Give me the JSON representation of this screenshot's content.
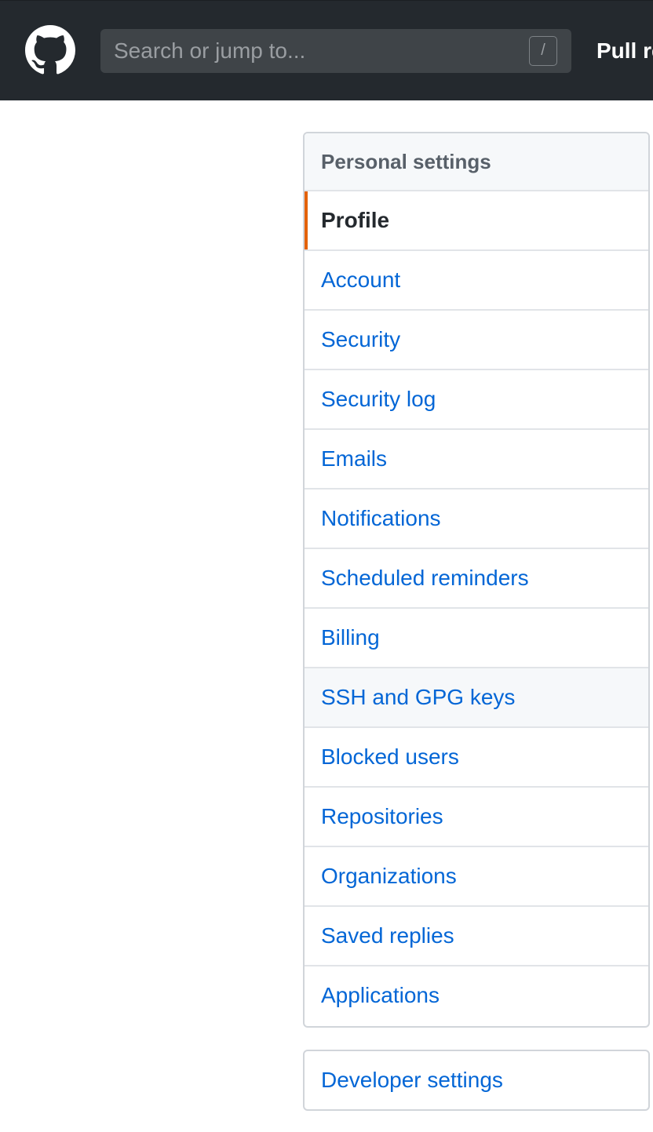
{
  "header": {
    "logo_icon": "github-mark-icon",
    "search": {
      "placeholder": "Search or jump to...",
      "shortcut": "/"
    },
    "nav_link": "Pull re"
  },
  "settings_menu": {
    "heading": "Personal settings",
    "items": [
      {
        "label": "Profile",
        "selected": true
      },
      {
        "label": "Account"
      },
      {
        "label": "Security"
      },
      {
        "label": "Security log"
      },
      {
        "label": "Emails"
      },
      {
        "label": "Notifications"
      },
      {
        "label": "Scheduled reminders"
      },
      {
        "label": "Billing"
      },
      {
        "label": "SSH and GPG keys",
        "hovered": true
      },
      {
        "label": "Blocked users"
      },
      {
        "label": "Repositories"
      },
      {
        "label": "Organizations"
      },
      {
        "label": "Saved replies"
      },
      {
        "label": "Applications"
      }
    ]
  },
  "developer_menu": {
    "items": [
      {
        "label": "Developer settings"
      }
    ]
  },
  "colors": {
    "header_bg": "#24292e",
    "link": "#0366d6",
    "selected_accent": "#e36209"
  }
}
